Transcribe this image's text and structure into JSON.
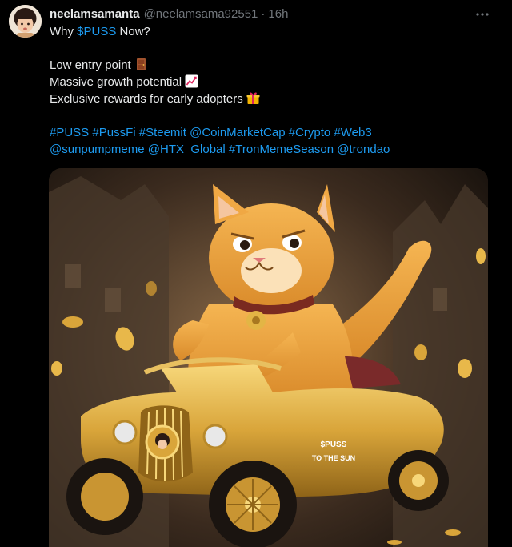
{
  "tweet": {
    "author": {
      "display_name": "neelamsamanta",
      "handle": "@neelamsama92551",
      "separator": "·",
      "time": "16h"
    },
    "more_icon": "more-horizontal-icon",
    "text": {
      "line1_prefix": "Why ",
      "line1_cashtag": "$PUSS",
      "line1_suffix": " Now?",
      "point1": "Low entry point",
      "point1_icon": "door-emoji-icon",
      "point2": "Massive growth potential",
      "point2_icon": "chart-increasing-emoji-icon",
      "point3": "Exclusive rewards for early adopters",
      "point3_icon": "gift-emoji-icon",
      "tags_line1": [
        "#PUSS",
        "#PussFi",
        "#Steemit",
        "@CoinMarketCap",
        "#Crypto",
        "#Web3"
      ],
      "tags_line2": [
        "@sunpumpmeme",
        "@HTX_Global",
        "#TronMemeSeason",
        "@trondao"
      ]
    },
    "media": {
      "car_text_line1": "$PUSS",
      "car_text_line2": "TO THE SUN"
    },
    "colors": {
      "background": "#000000",
      "text": "#e7e9ea",
      "muted": "#71767b",
      "link": "#1d9bf0"
    }
  }
}
